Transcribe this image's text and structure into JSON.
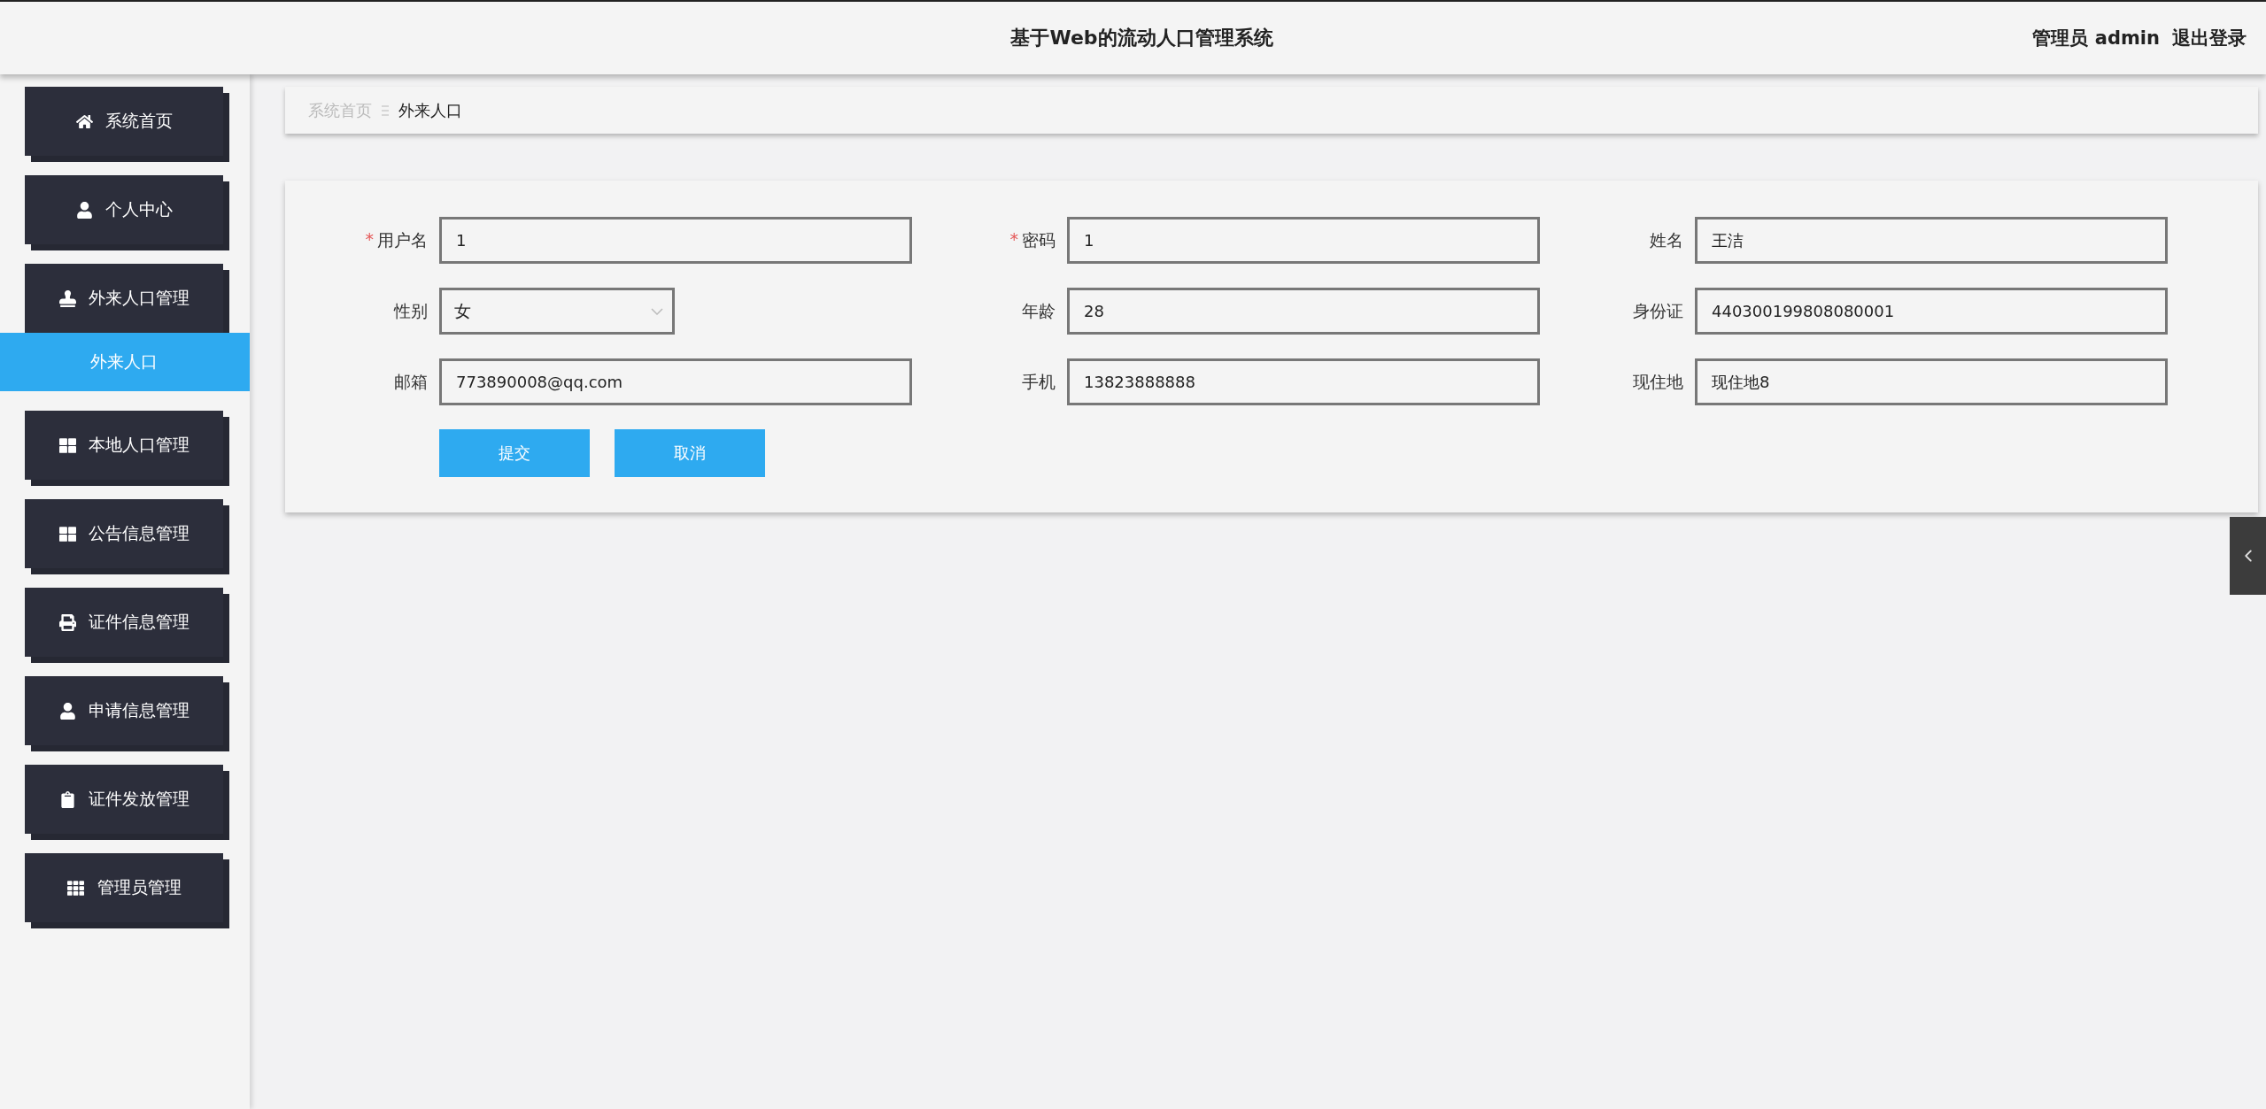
{
  "header": {
    "title": "基于Web的流动人口管理系统",
    "user_label": "管理员 admin",
    "logout": "退出登录"
  },
  "sidebar": {
    "items": [
      {
        "label": "系统首页",
        "expanded": false
      },
      {
        "label": "个人中心",
        "expanded": false
      },
      {
        "label": "外来人口管理",
        "expanded": true,
        "children": [
          {
            "label": "外来人口",
            "selected": true
          }
        ]
      },
      {
        "label": "本地人口管理",
        "expanded": false
      },
      {
        "label": "公告信息管理",
        "expanded": false
      },
      {
        "label": "证件信息管理",
        "expanded": false
      },
      {
        "label": "申请信息管理",
        "expanded": false
      },
      {
        "label": "证件发放管理",
        "expanded": false
      },
      {
        "label": "管理员管理",
        "expanded": false
      }
    ]
  },
  "breadcrumb": [
    {
      "label": "系统首页",
      "current": false
    },
    {
      "label": "外来人口",
      "current": true
    }
  ],
  "form": {
    "fields": [
      {
        "kind": "text",
        "label": "用户名",
        "required_mark": "*",
        "value": "1"
      },
      {
        "kind": "text",
        "label": "密码",
        "required_mark": "*",
        "value": "1"
      },
      {
        "kind": "text",
        "label": "姓名",
        "value": "王洁"
      },
      {
        "kind": "select",
        "label": "性别",
        "value": "女"
      },
      {
        "kind": "text",
        "label": "年龄",
        "value": "28"
      },
      {
        "kind": "text",
        "label": "身份证",
        "value": "440300199808080001"
      },
      {
        "kind": "text",
        "label": "邮箱",
        "value": "773890008@qq.com"
      },
      {
        "kind": "text",
        "label": "手机",
        "value": "13823888888"
      },
      {
        "kind": "text",
        "label": "现住地",
        "value": "现住地8"
      }
    ],
    "buttons": [
      "提交",
      "取消"
    ]
  }
}
